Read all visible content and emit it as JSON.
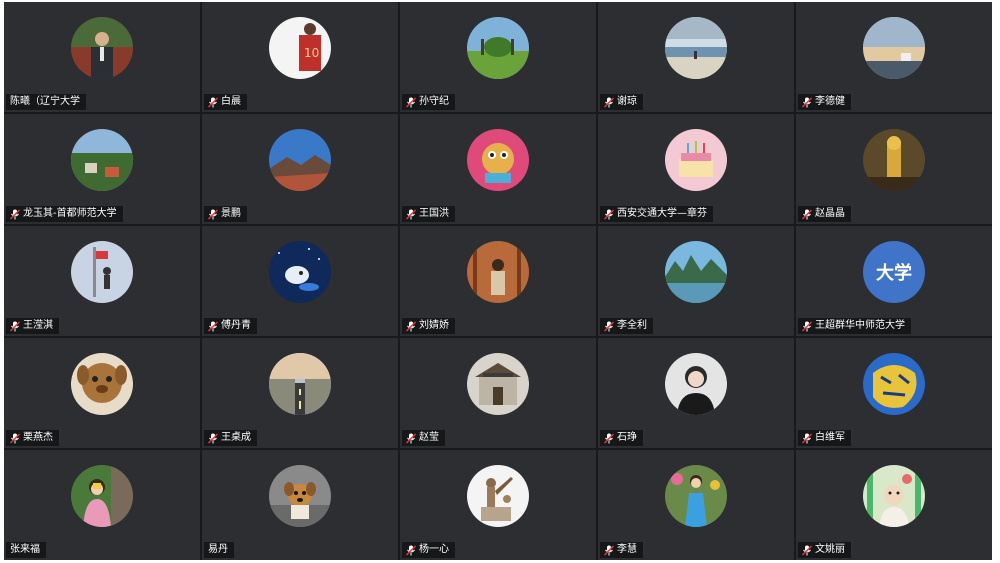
{
  "participants": [
    {
      "name": "陈曦（辽宁大学",
      "muted": false,
      "avatar": "person-suit-photo"
    },
    {
      "name": "白晨",
      "muted": true,
      "avatar": "basketball-jersey-photo"
    },
    {
      "name": "孙守纪",
      "muted": true,
      "avatar": "green-field-photo"
    },
    {
      "name": "谢琼",
      "muted": true,
      "avatar": "beach-photo"
    },
    {
      "name": "李德健",
      "muted": true,
      "avatar": "sunset-photo"
    },
    {
      "name": "龙玉其-首都师范大学",
      "muted": true,
      "avatar": "village-photo"
    },
    {
      "name": "景鹏",
      "muted": true,
      "avatar": "mountain-photo"
    },
    {
      "name": "王国洪",
      "muted": true,
      "avatar": "cartoon-animal-photo"
    },
    {
      "name": "西安交通大学—章芬",
      "muted": true,
      "avatar": "birthday-cake-photo"
    },
    {
      "name": "赵晶晶",
      "muted": true,
      "avatar": "yellow-figure-photo"
    },
    {
      "name": "王滢淇",
      "muted": true,
      "avatar": "climber-photo"
    },
    {
      "name": "傅丹青",
      "muted": true,
      "avatar": "space-cartoon-photo"
    },
    {
      "name": "刘婧娇",
      "muted": true,
      "avatar": "forest-person-photo"
    },
    {
      "name": "李全利",
      "muted": true,
      "avatar": "lake-mountain-photo"
    },
    {
      "name": "王超群华中师范大学",
      "muted": true,
      "avatar_text": "大学"
    },
    {
      "name": "栗燕杰",
      "muted": true,
      "avatar": "plush-dog-photo"
    },
    {
      "name": "王桌成",
      "muted": true,
      "avatar": "road-photo"
    },
    {
      "name": "赵莹",
      "muted": true,
      "avatar": "building-photo"
    },
    {
      "name": "石琤",
      "muted": true,
      "avatar": "portrait-photo"
    },
    {
      "name": "白维军",
      "muted": true,
      "avatar": "tiger-art-photo"
    },
    {
      "name": "张来福",
      "muted": false,
      "avatar": "child-pink-photo"
    },
    {
      "name": "易丹",
      "muted": false,
      "avatar": "puppy-photo"
    },
    {
      "name": "杨一心",
      "muted": true,
      "avatar": "statue-photo"
    },
    {
      "name": "李慧",
      "muted": true,
      "avatar": "woman-blue-dress-photo"
    },
    {
      "name": "文姚丽",
      "muted": true,
      "avatar": "baby-photo"
    }
  ]
}
